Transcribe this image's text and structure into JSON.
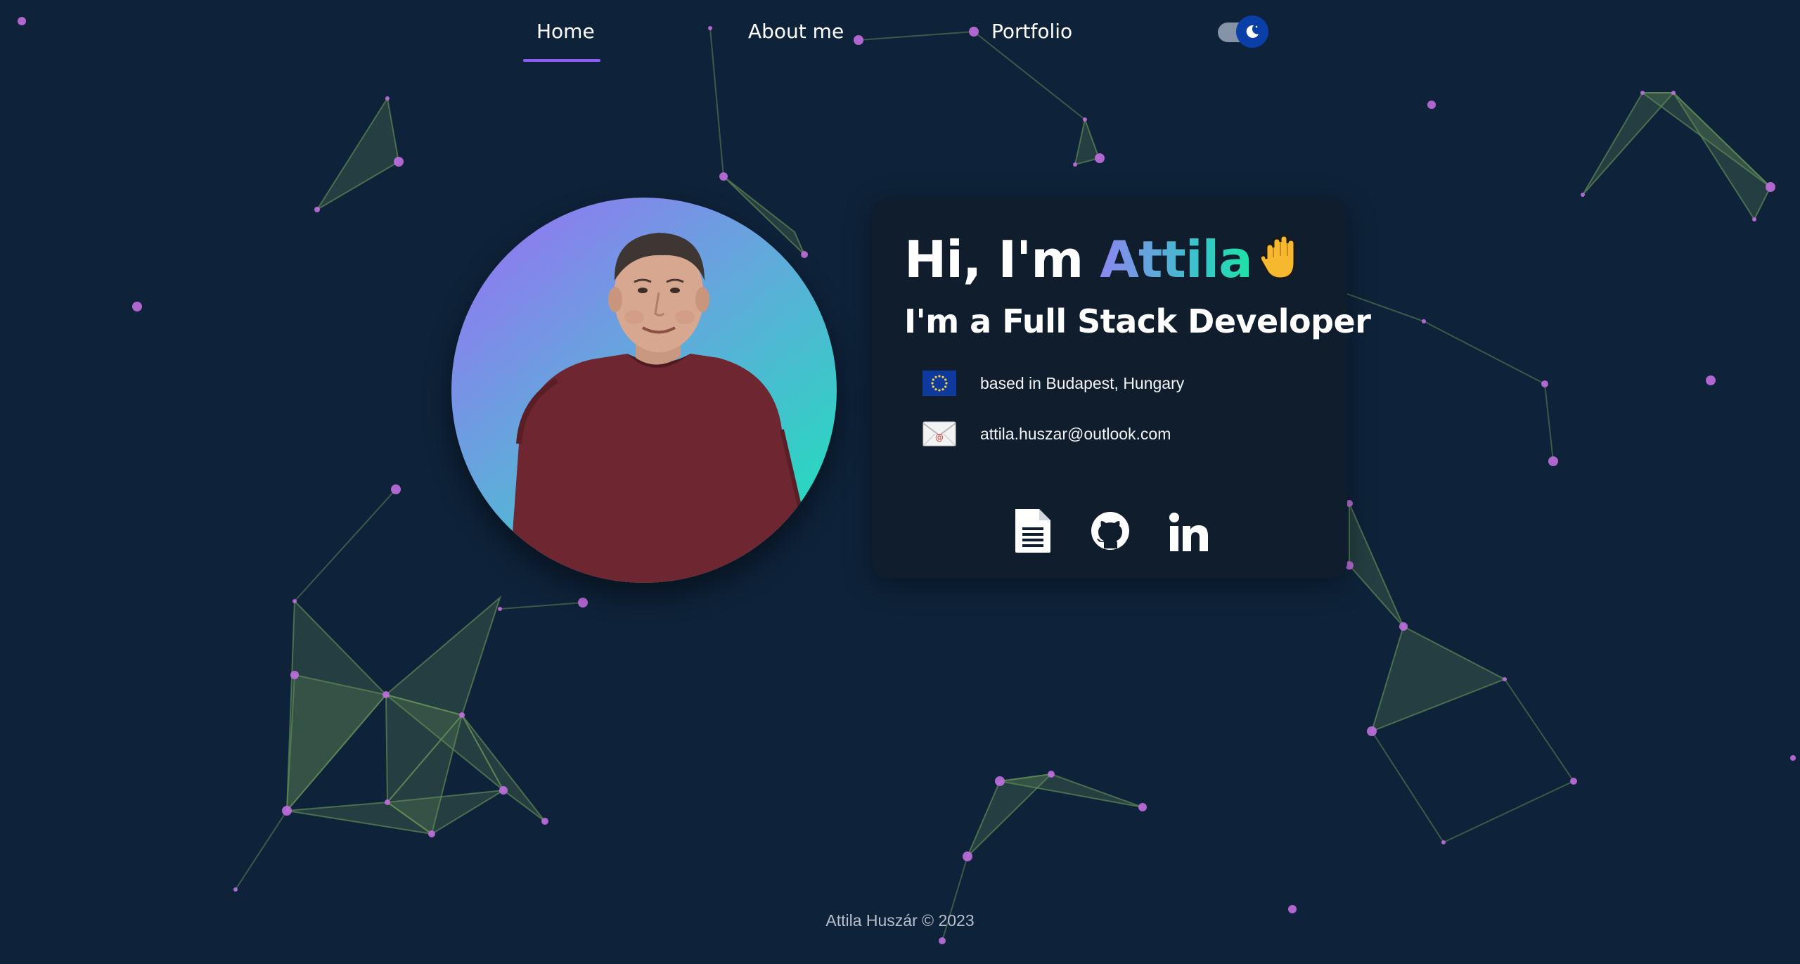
{
  "nav": {
    "items": [
      {
        "label": "Home",
        "active": true
      },
      {
        "label": "About me",
        "active": false
      },
      {
        "label": "Portfolio",
        "active": false
      }
    ],
    "theme_toggle": {
      "icon": "moon-icon",
      "state": "dark"
    }
  },
  "hero": {
    "greeting_prefix": "Hi, I'm ",
    "name": "Attila",
    "greeting_emoji": "raised-hand-icon",
    "role": "I'm a Full Stack Developer",
    "location": {
      "icon": "eu-flag-icon",
      "text": "based in Budapest, Hungary"
    },
    "email": {
      "icon": "email-icon",
      "text": "attila.huszar@outlook.com"
    },
    "socials": [
      {
        "name": "resume",
        "icon": "document-icon"
      },
      {
        "name": "github",
        "icon": "github-icon"
      },
      {
        "name": "linkedin",
        "icon": "linkedin-icon"
      }
    ]
  },
  "footer": {
    "author": "Attila Huszár",
    "copyright_symbol": "©",
    "year": "2023"
  },
  "colors": {
    "background": "#0e2239",
    "card": "#0f1d2c",
    "accent_purple": "#8b5cf6",
    "accent_teal": "#1ee3a5",
    "particle": "#c26ee0",
    "mesh": "#5f8a55"
  }
}
